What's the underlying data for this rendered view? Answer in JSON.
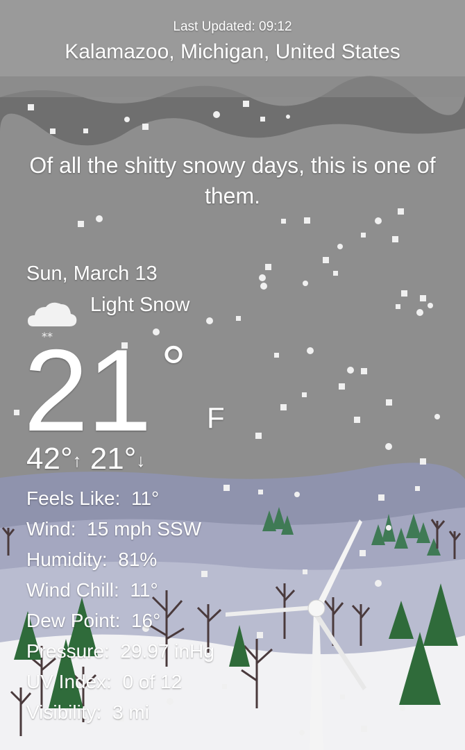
{
  "header": {
    "last_updated": "Last Updated: 09:12",
    "location": "Kalamazoo, Michigan, United States"
  },
  "quip": "Of all the shitty snowy days, this is one of them.",
  "forecast": {
    "date": "Sun, March 13",
    "condition": "Light Snow",
    "condition_icon": "cloud-snow-icon",
    "temperature": "21",
    "degree_symbol": "°",
    "unit": "F",
    "high": "42°",
    "high_arrow": "↑",
    "low": "21°",
    "low_arrow": "↓"
  },
  "details": [
    {
      "label": "Feels Like:",
      "value": "11°"
    },
    {
      "label": "Wind:",
      "value": "15 mph SSW"
    },
    {
      "label": "Humidity:",
      "value": "81%"
    },
    {
      "label": "Wind Chill:",
      "value": "11°"
    },
    {
      "label": "Dew Point:",
      "value": "16°"
    },
    {
      "label": "Pressure:",
      "value": "29.97 inHg"
    },
    {
      "label": "UV Index:",
      "value": "0 of 12"
    },
    {
      "label": "Visibility:",
      "value": "3 mi"
    }
  ],
  "colors": {
    "sky": "#8e8e8e",
    "cloud_band": "#6f6f6f",
    "hills_far": "#8f93ad",
    "snow": "#f2f2f4",
    "tree": "#2f6b3a"
  }
}
